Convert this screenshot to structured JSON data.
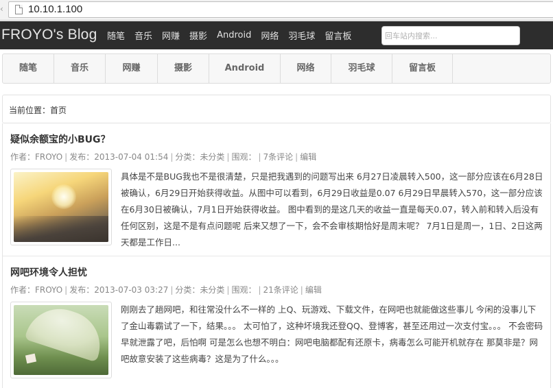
{
  "browser": {
    "url": "10.10.1.100"
  },
  "site": {
    "brand": "FROYO's Blog",
    "top_nav": [
      "随笔",
      "音乐",
      "网赚",
      "摄影",
      "Android",
      "网络",
      "羽毛球",
      "留言板"
    ],
    "search_placeholder": "回车站内搜索..."
  },
  "menu": {
    "items": [
      "随笔",
      "音乐",
      "网赚",
      "摄影",
      "Android",
      "网络",
      "羽毛球",
      "留言板"
    ]
  },
  "breadcrumb": {
    "text": "当前位置：首页"
  },
  "posts": [
    {
      "title": "疑似余额宝的小BUG？",
      "author_label": "作者：FROYO",
      "date_label": "发布：2013-07-04 01:54",
      "category_label": "分类：未分类",
      "views_label": "围观：",
      "comments_label": "7条评论",
      "edit_label": "编辑",
      "thumbnail_icon": "railway-sunset-image",
      "excerpt": "具体是不是BUG我也不是很清楚，只是把我遇到的问题写出来 6月27日凌晨转入500，这一部分应该在6月28日被确认，6月29日开始获得收益。从图中可以看到，6月29日收益是0.07 6月29日早晨转入570，这一部分应该在6月30日被确认，7月1日开始获得收益。 图中看到的是这几天的收益一直是每天0.07，转入前和转入后没有任何区别，这是不是有点问题呢 后来又想了一下，会不会审核期恰好是周末呢？ 7月1日是周一，1日、2日这两天都是工作日..."
    },
    {
      "title": "网吧环境令人担忧",
      "author_label": "作者：FROYO",
      "date_label": "发布：2013-07-03 03:27",
      "category_label": "分类：未分类",
      "views_label": "围观：",
      "comments_label": "21条评论",
      "edit_label": "编辑",
      "thumbnail_icon": "umbrella-grass-image",
      "excerpt": "刚刚去了趟网吧，和往常没什么不一样的 上Q、玩游戏、下载文件，在网吧也就能做这些事儿 今闲的没事儿下了金山毒霸试了一下，结果。。。 太可怕了，这种坏境我还登QQ、登博客，甚至还用过一次支付宝。。。 不会密码早就泄露了吧，后怕啊 可是怎么也想不明白：网吧电脑都配有还原卡，病毒怎么可能开机就存在 那莫非是？网吧故意安装了这些病毒？这是为了什么。。。"
    }
  ]
}
